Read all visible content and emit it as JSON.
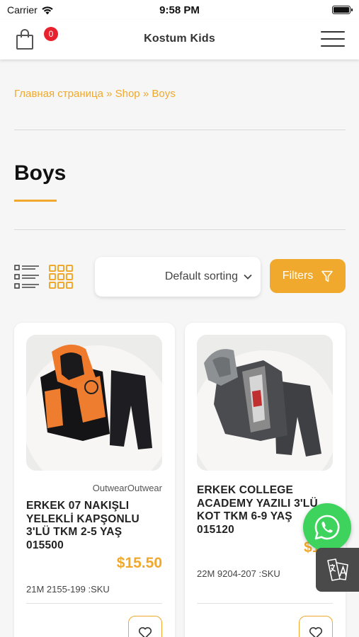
{
  "status_bar": {
    "carrier": "Carrier",
    "time": "9:58 PM"
  },
  "header": {
    "title": "Kostum Kids",
    "cart_count": "0"
  },
  "breadcrumb": {
    "items": [
      "Главная страница",
      "Shop",
      "Boys"
    ],
    "separator": " » "
  },
  "page": {
    "title": "Boys"
  },
  "toolbar": {
    "sort_label": "Default sorting",
    "filters_label": "Filters"
  },
  "products": [
    {
      "category": "OutwearOutwear",
      "name": "ERKEK 07 NAKIŞLI YELEKLİ KAPŞONLU 3'LÜ TKM 2-5 YAŞ 015500",
      "price": "$15.50",
      "sku": "21M 2155-199 :SKU"
    },
    {
      "category": "",
      "name": "ERKEK COLLEGE ACADEMY YAZILI 3'LÜ KOT TKM 6-9 YAŞ 015120",
      "price": "$15.",
      "sku": "22M 9204-207 :SKU"
    }
  ],
  "colors": {
    "accent": "#f0a92c",
    "badge": "#e8222d",
    "whatsapp": "#3dd35c"
  }
}
